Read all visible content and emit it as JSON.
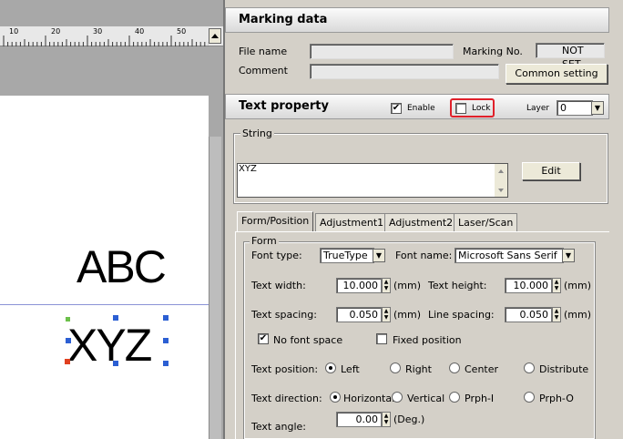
{
  "ruler": {
    "ticks": [
      "10",
      "20",
      "30",
      "40",
      "50"
    ]
  },
  "canvas": {
    "text_1": "ABC",
    "text_2": "XYZ"
  },
  "marking_data": {
    "title": "Marking data",
    "file_name_label": "File name",
    "comment_label": "Comment",
    "marking_no_label": "Marking No.",
    "marking_no_value": "NOT SET",
    "common_setting_label": "Common setting"
  },
  "text_property": {
    "title": "Text property",
    "enable_label": "Enable",
    "enable_checked": true,
    "lock_label": "Lock",
    "lock_checked": false,
    "layer_label": "Layer",
    "layer_value": "0"
  },
  "string_group": {
    "label": "String",
    "value": "XYZ",
    "edit_label": "Edit"
  },
  "tabs": [
    {
      "label": "Form/Position",
      "active": true
    },
    {
      "label": "Adjustment1",
      "active": false
    },
    {
      "label": "Adjustment2",
      "active": false
    },
    {
      "label": "Laser/Scan",
      "active": false
    }
  ],
  "form": {
    "group_label": "Form",
    "font_type_label": "Font type:",
    "font_type_value": "TrueType",
    "font_name_label": "Font name:",
    "font_name_value": "Microsoft Sans Serif",
    "text_width_label": "Text width:",
    "text_width_value": "10.000",
    "text_height_label": "Text height:",
    "text_height_value": "10.000",
    "text_spacing_label": "Text spacing:",
    "text_spacing_value": "0.050",
    "line_spacing_label": "Line spacing:",
    "line_spacing_value": "0.050",
    "unit_mm": "(mm)",
    "no_font_space_label": "No font space",
    "no_font_space_checked": true,
    "fixed_position_label": "Fixed position",
    "fixed_position_checked": false,
    "text_position_label": "Text position:",
    "text_position_options": [
      "Left",
      "Right",
      "Center",
      "Distribute"
    ],
    "text_position_selected": "Left",
    "text_direction_label": "Text direction:",
    "text_direction_options": [
      "Horizontal",
      "Vertical",
      "Prph-I",
      "Prph-O"
    ],
    "text_direction_selected": "Horizontal",
    "text_angle_label": "Text angle:",
    "text_angle_value": "0.00",
    "unit_deg": "(Deg.)"
  },
  "colors": {
    "lock_highlight": "#e0202a",
    "handle_blue": "#2c5fd3",
    "handle_green": "#6cc04a",
    "handle_red": "#e04020"
  }
}
